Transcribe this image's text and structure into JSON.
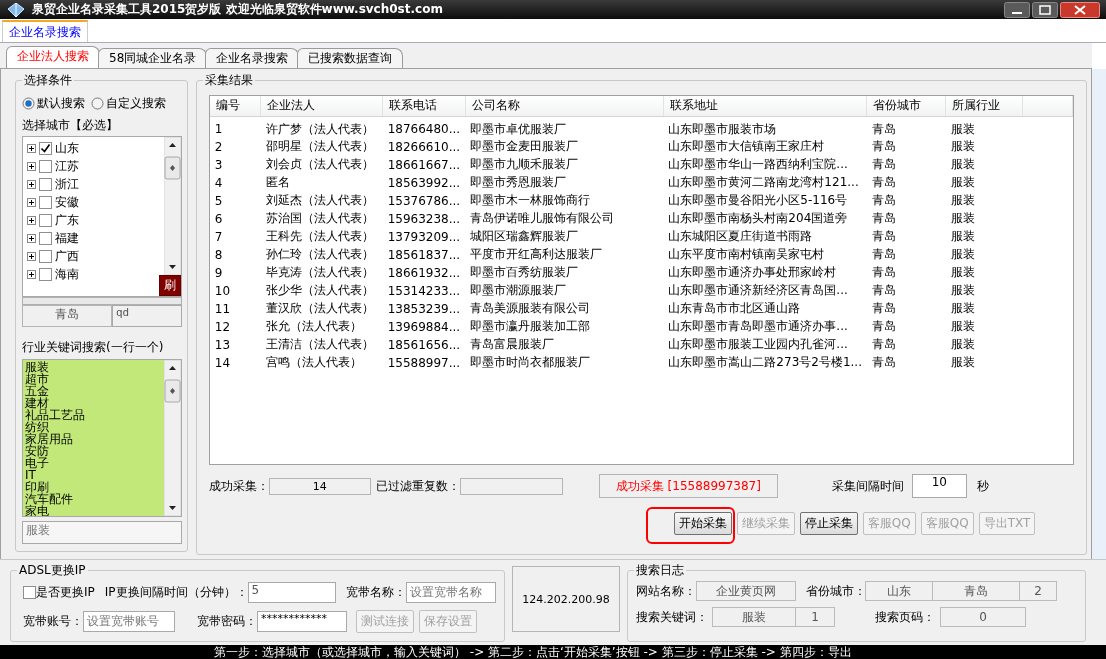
{
  "window": {
    "title": "泉贸企业名录采集工具2015贺岁版 欢迎光临泉贸软件www.svch0st.com"
  },
  "top_tabs": [
    {
      "label": "企业名录搜索",
      "selected": true
    }
  ],
  "sub_tabs": [
    {
      "label": "企业法人搜索",
      "selected": true
    },
    {
      "label": "58同城企业名录",
      "selected": false
    },
    {
      "label": "企业名录搜索",
      "selected": false
    },
    {
      "label": "已搜索数据查询",
      "selected": false
    }
  ],
  "conditions": {
    "title": "选择条件",
    "modes": [
      {
        "label": "默认搜索",
        "selected": true
      },
      {
        "label": "自定义搜索",
        "selected": false
      }
    ],
    "city_label": "选择城市【必选】",
    "provinces": [
      {
        "name": "山东",
        "checked": true
      },
      {
        "name": "江苏",
        "checked": false
      },
      {
        "name": "浙江",
        "checked": false
      },
      {
        "name": "安徽",
        "checked": false
      },
      {
        "name": "广东",
        "checked": false
      },
      {
        "name": "福建",
        "checked": false
      },
      {
        "name": "广西",
        "checked": false
      },
      {
        "name": "海南",
        "checked": false
      }
    ],
    "refresh_button": "刷",
    "city_name": "青岛",
    "city_code": "qd",
    "keyword_label": "行业关键词搜索(一行一个)",
    "keywords": [
      "服装",
      "超市",
      "五金",
      "建材",
      "礼品工艺品",
      "纺织",
      "家居用品",
      "安防",
      "电子",
      "IT",
      "印刷",
      "汽车配件",
      "家电"
    ],
    "keyword_value": "服装"
  },
  "results": {
    "title": "采集结果",
    "columns": [
      "编号",
      "企业法人",
      "联系电话",
      "公司名称",
      "联系地址",
      "省份城市",
      "所属行业"
    ],
    "rows": [
      [
        "1",
        "许广梦（法人代表）",
        "18766480...",
        "即墨市卓优服装厂",
        "山东即墨市服装市场",
        "青岛",
        "服装"
      ],
      [
        "2",
        "邵明星（法人代表）",
        "18266610...",
        "即墨市金麦田服装厂",
        "山东即墨市大信镇南王家庄村",
        "青岛",
        "服装"
      ],
      [
        "3",
        "刘会贞（法人代表）",
        "18661667...",
        "即墨市九顺禾服装厂",
        "山东即墨市华山一路西纳利宝院...",
        "青岛",
        "服装"
      ],
      [
        "4",
        "匿名",
        "18563992...",
        "即墨市秀恩服装厂",
        "山东即墨市黄河二路南龙湾村121...",
        "青岛",
        "服装"
      ],
      [
        "5",
        "刘延杰（法人代表）",
        "15376786...",
        "即墨市木一林服饰商行",
        "山东即墨市曼谷阳光小区5-116号",
        "青岛",
        "服装"
      ],
      [
        "6",
        "苏治国（法人代表）",
        "15963238...",
        "青岛伊诺唯儿服饰有限公司",
        "山东即墨市南杨头村南204国道旁",
        "青岛",
        "服装"
      ],
      [
        "7",
        "王科先（法人代表）",
        "13793209...",
        "城阳区瑞鑫辉服装厂",
        "山东城阳区夏庄街道书雨路",
        "青岛",
        "服装"
      ],
      [
        "8",
        "孙仁玲（法人代表）",
        "18561837...",
        "平度市开红高利达服装厂",
        "山东平度市南村镇南吴家屯村",
        "青岛",
        "服装"
      ],
      [
        "9",
        "毕克涛（法人代表）",
        "18661932...",
        "即墨市百秀纺服装厂",
        "山东即墨市通济办事处邢家岭村",
        "青岛",
        "服装"
      ],
      [
        "10",
        "张少华（法人代表）",
        "15314233...",
        "即墨市潮源服装厂",
        "山东即墨市通济新经济区青岛国...",
        "青岛",
        "服装"
      ],
      [
        "11",
        "董汉欣（法人代表）",
        "13853239...",
        "青岛美源服装有限公司",
        "山东青岛市市北区通山路",
        "青岛",
        "服装"
      ],
      [
        "12",
        "张允（法人代表）",
        "13969884...",
        "即墨市瀛丹服装加工部",
        "山东即墨市青岛即墨市通济办事...",
        "青岛",
        "服装"
      ],
      [
        "13",
        "王清洁（法人代表）",
        "18561656...",
        "青岛富晨服装厂",
        "山东即墨市服装工业园内孔雀河...",
        "青岛",
        "服装"
      ],
      [
        "14",
        "宫鸣（法人代表）",
        "15588997...",
        "即墨市时尚衣都服装厂",
        "山东即墨市嵩山二路273号2号楼1...",
        "青岛",
        "服装"
      ]
    ],
    "success_label": "成功采集：",
    "success_count": "14",
    "filtered_label": "已过滤重复数：",
    "message": "成功采集 [15588997387]",
    "interval_label": "采集间隔时间",
    "interval_value": "10",
    "interval_unit": "秒",
    "buttons": [
      {
        "label": "开始采集",
        "disabled": false,
        "highlighted": true
      },
      {
        "label": "继续采集",
        "disabled": true,
        "highlighted": false
      },
      {
        "label": "停止采集",
        "disabled": false,
        "highlighted": false
      },
      {
        "label": "客服QQ",
        "disabled": true,
        "highlighted": false
      },
      {
        "label": "客服QQ",
        "disabled": true,
        "highlighted": false
      },
      {
        "label": "导出TXT",
        "disabled": true,
        "highlighted": false
      }
    ]
  },
  "adsl": {
    "title": "ADSL更换IP",
    "change_ip": {
      "label": "是否更换IP",
      "checked": false
    },
    "interval_label": "IP更换间隔时间（分钟）：",
    "interval_value": "5",
    "name_label": "宽带名称：",
    "name_placeholder": "设置宽带名称",
    "account_label": "宽带账号：",
    "account_placeholder": "设置宽带账号",
    "password_label": "宽带密码：",
    "password_value": "************",
    "buttons": [
      {
        "label": "测试连接",
        "disabled": true
      },
      {
        "label": "保存设置",
        "disabled": true
      }
    ],
    "ip": "124.202.200.98"
  },
  "search_log": {
    "title": "搜索日志",
    "site_label": "网站名称：",
    "site_value": "企业黄页网",
    "city_label": "省份城市：",
    "province": "山东",
    "city": "青岛",
    "city_count": "2",
    "keyword_label": "搜索关键词：",
    "keyword_value": "服装",
    "keyword_count": "1",
    "page_label": "搜索页码：",
    "page_value": "0"
  },
  "status_bar": "第一步：选择城市（或选择城市，输入关键词） -> 第二步：点击‘开始采集’按钮  -> 第三步：停止采集  -> 第四步：导出"
}
